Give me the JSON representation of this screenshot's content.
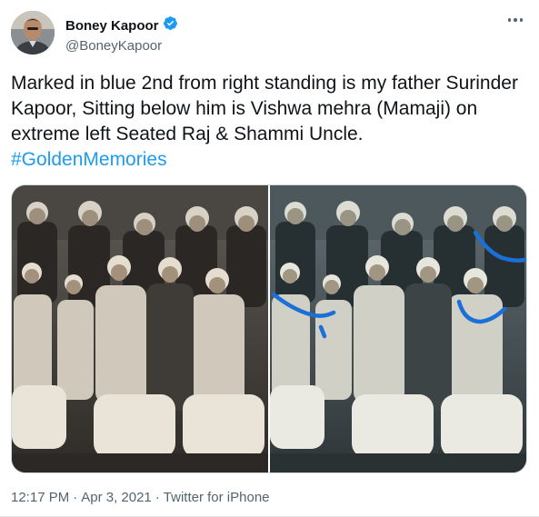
{
  "user": {
    "display_name": "Boney Kapoor",
    "handle": "@BoneyKapoor",
    "verified_icon": "verified-badge-icon",
    "verified_color": "#1d9bf0"
  },
  "menu": {
    "icon": "more-options-icon"
  },
  "tweet": {
    "text": "Marked in blue 2nd from right standing is my father Surinder Kapoor, Sitting below him is Vishwa mehra (Mamaji) on extreme left Seated Raj & Shammi Uncle.",
    "hashtag": "#GoldenMemories"
  },
  "media": {
    "photos": [
      {
        "alt": "vintage group photo"
      },
      {
        "alt": "vintage group photo with blue markings"
      }
    ],
    "marking_color": "#1a6fd8"
  },
  "meta": {
    "time": "12:17 PM",
    "date": "Apr 3, 2021",
    "source": "Twitter for iPhone",
    "separator": "·"
  },
  "colors": {
    "text": "#0f1419",
    "secondary": "#536471",
    "link": "#1d9bf0"
  }
}
